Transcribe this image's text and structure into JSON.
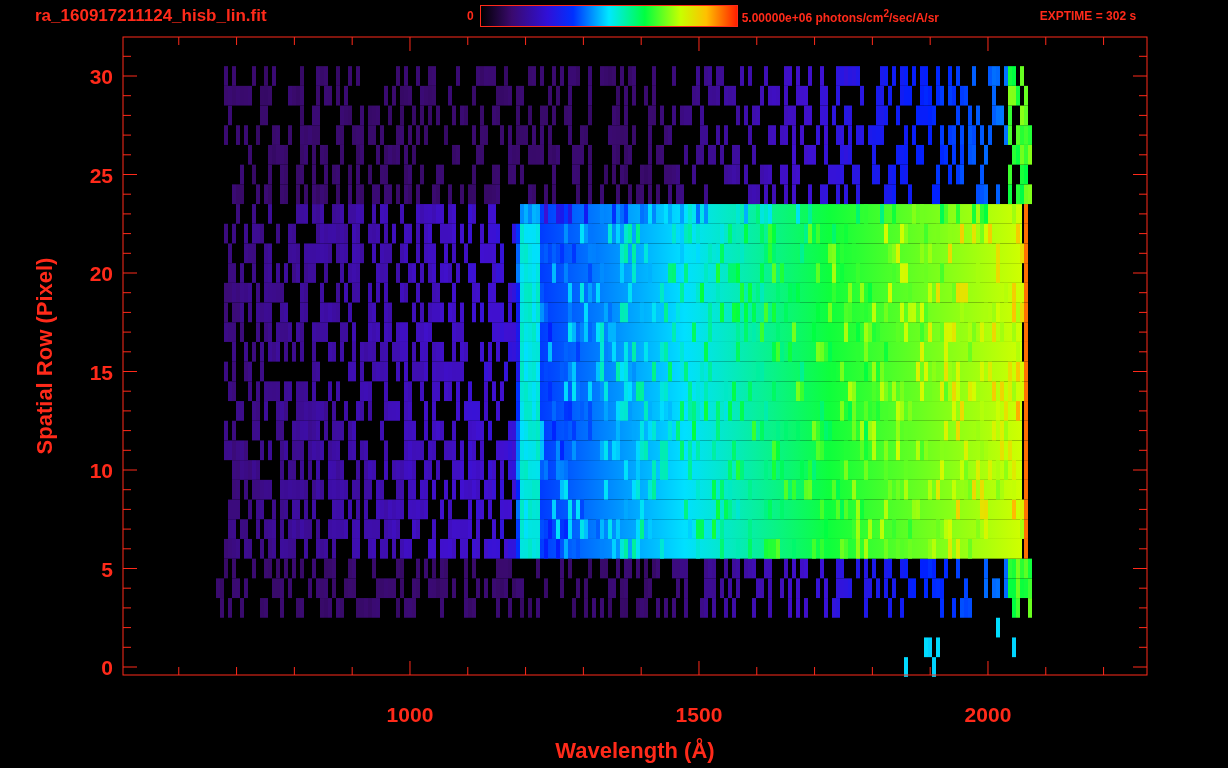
{
  "header": {
    "title": "ra_160917211124_hisb_lin.fit",
    "colorbar": {
      "min_label": "0",
      "max_label": "5.00000e+06 photons/cm$^{2}$/sec/A/sr"
    },
    "exptime": "EXPTIME = 302 s"
  },
  "plot": {
    "xlabel": "Wavelength (Å)",
    "ylabel": "Spatial Row (Pixel)",
    "xtick_labels": [
      "1000",
      "1500",
      "2000"
    ],
    "ytick_labels": [
      "30",
      "25",
      "20",
      "15",
      "10",
      "5",
      "0"
    ]
  }
}
